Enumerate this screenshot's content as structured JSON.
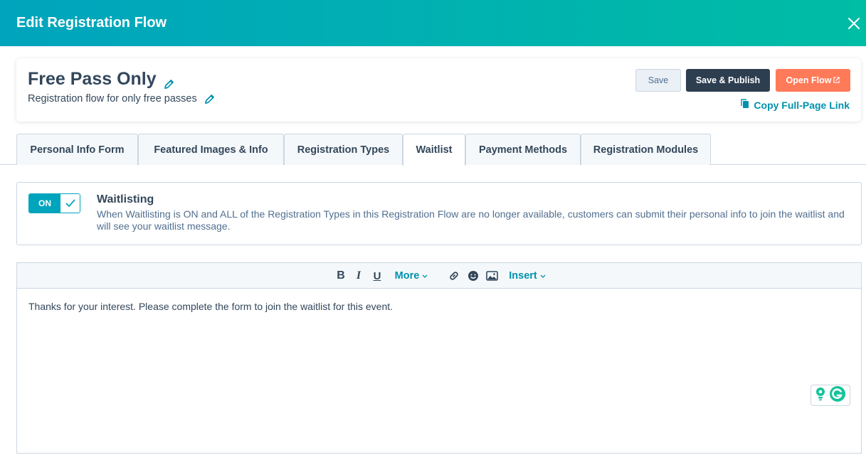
{
  "header": {
    "title": "Edit Registration Flow"
  },
  "flow": {
    "name": "Free Pass Only",
    "description": "Registration flow for only free passes"
  },
  "actions": {
    "save": "Save",
    "save_publish": "Save & Publish",
    "open_flow": "Open Flow",
    "copy_link": "Copy Full-Page Link"
  },
  "tabs": [
    {
      "label": "Personal Info Form"
    },
    {
      "label": "Featured Images & Info"
    },
    {
      "label": "Registration Types"
    },
    {
      "label": "Waitlist",
      "active": true
    },
    {
      "label": "Payment Methods"
    },
    {
      "label": "Registration Modules"
    }
  ],
  "waitlist": {
    "toggle_label": "ON",
    "title": "Waitlisting",
    "description": "When Waitlisting is ON and ALL of the Registration Types in this Registration Flow are no longer available, customers can submit their personal info to join the waitlist and will see your waitlist message."
  },
  "editor": {
    "toolbar": {
      "more": "More",
      "insert": "Insert"
    },
    "content": "Thanks for your interest. Please complete the form to join the waitlist for this event."
  },
  "colors": {
    "header_gradient_start": "#00a4bd",
    "header_gradient_end": "#00bda5",
    "primary_dark": "#2d3e50",
    "accent_orange": "#ff7a59",
    "link_teal": "#0091ae"
  }
}
